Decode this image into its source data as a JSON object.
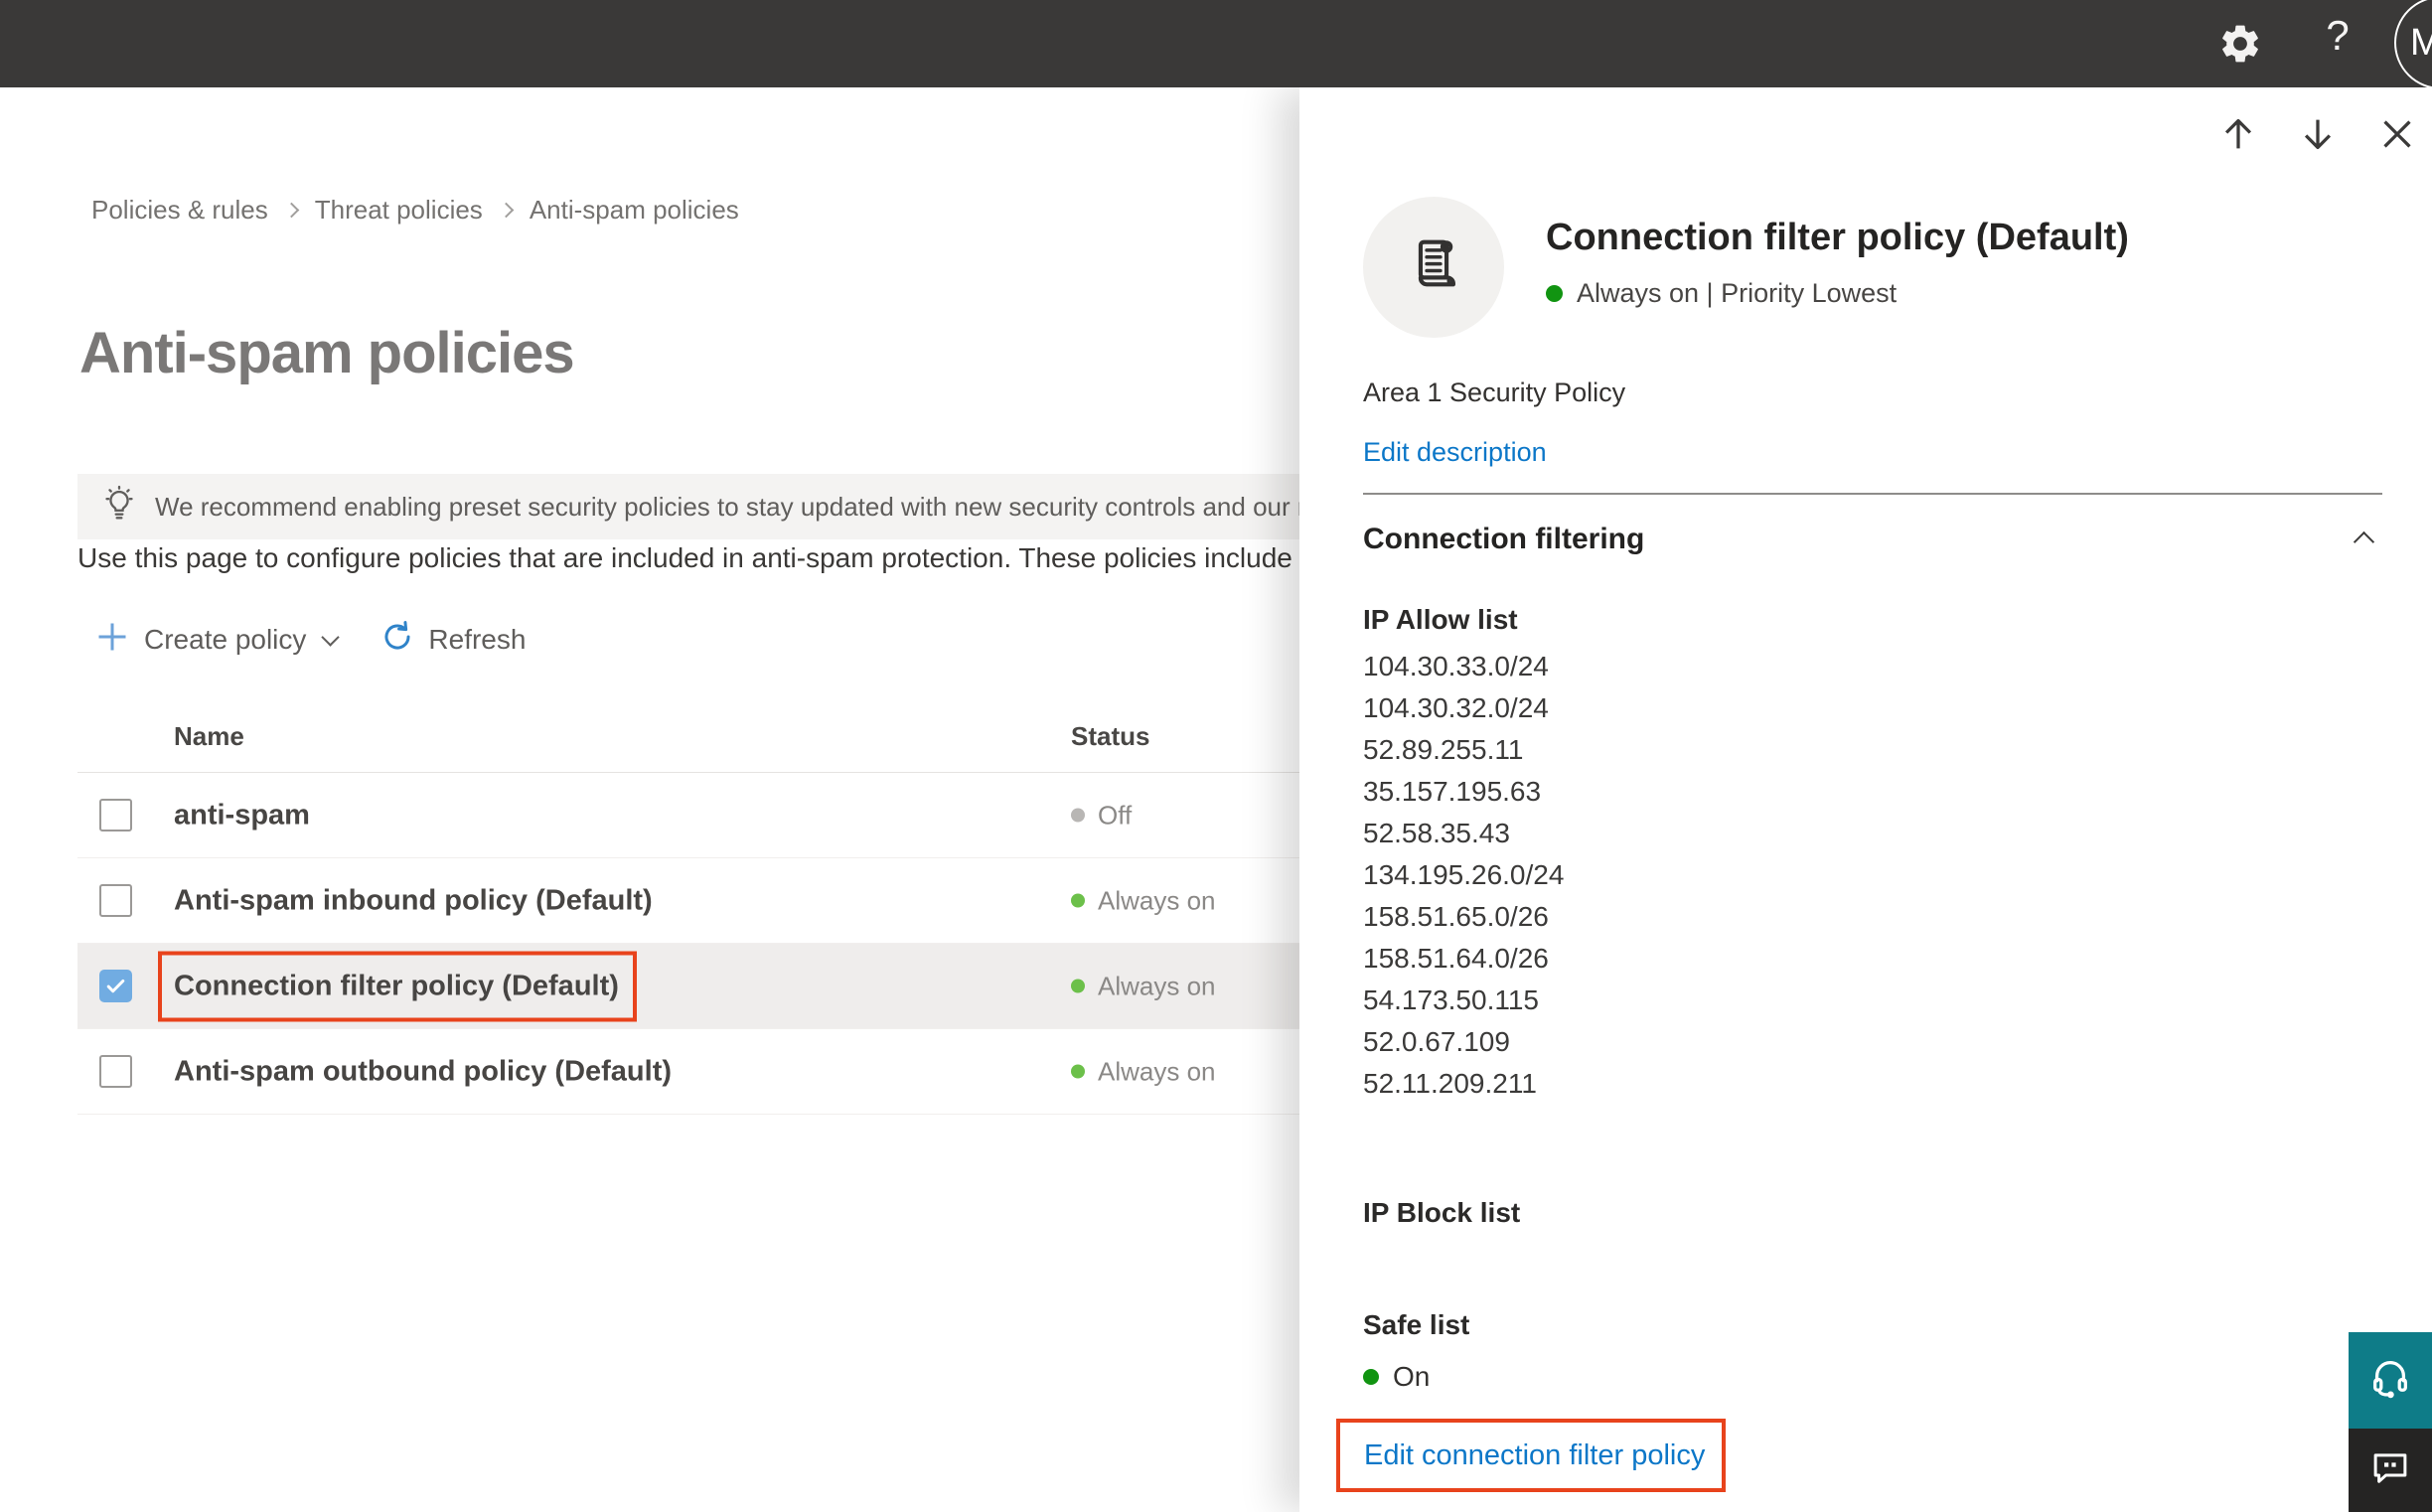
{
  "topbar": {
    "help_label": "?",
    "avatar_initial": "M"
  },
  "breadcrumb": {
    "items": [
      "Policies & rules",
      "Threat policies",
      "Anti-spam policies"
    ]
  },
  "page": {
    "title": "Anti-spam policies",
    "banner_text": "We recommend enabling preset security policies to stay updated with new security controls and our recomme",
    "intro_text": "Use this page to configure policies that are included in anti-spam protection. These policies include"
  },
  "toolbar": {
    "create_policy_label": "Create policy",
    "refresh_label": "Refresh"
  },
  "table": {
    "columns": {
      "name": "Name",
      "status": "Status"
    },
    "rows": [
      {
        "name": "anti-spam",
        "status": "Off",
        "checked": false,
        "selected": false,
        "highlighted": false
      },
      {
        "name": "Anti-spam inbound policy (Default)",
        "status": "Always on",
        "checked": false,
        "selected": false,
        "highlighted": false
      },
      {
        "name": "Connection filter policy (Default)",
        "status": "Always on",
        "checked": true,
        "selected": true,
        "highlighted": true
      },
      {
        "name": "Anti-spam outbound policy (Default)",
        "status": "Always on",
        "checked": false,
        "selected": false,
        "highlighted": false
      }
    ]
  },
  "panel": {
    "title": "Connection filter policy (Default)",
    "status_line": "Always on | Priority Lowest",
    "description": "Area 1 Security Policy",
    "edit_description_label": "Edit description",
    "section_title": "Connection filtering",
    "ip_allow_title": "IP Allow list",
    "ip_allow_items": [
      "104.30.33.0/24",
      "104.30.32.0/24",
      "52.89.255.11",
      "35.157.195.63",
      "52.58.35.43",
      "134.195.26.0/24",
      "158.51.65.0/26",
      "158.51.64.0/26",
      "54.173.50.115",
      "52.0.67.109",
      "52.11.209.211"
    ],
    "ip_block_title": "IP Block list",
    "safe_list_title": "Safe list",
    "safe_list_status": "On",
    "edit_policy_label": "Edit connection filter policy"
  },
  "colors": {
    "table_status_on": "#6cc04a",
    "table_status_off": "#b8b6b4",
    "panel_status_on": "#119411",
    "highlight_red": "#e8431c",
    "link_blue": "#0c77c8",
    "checkbox_blue": "#71ace2",
    "support_teal": "#0e7c88"
  }
}
